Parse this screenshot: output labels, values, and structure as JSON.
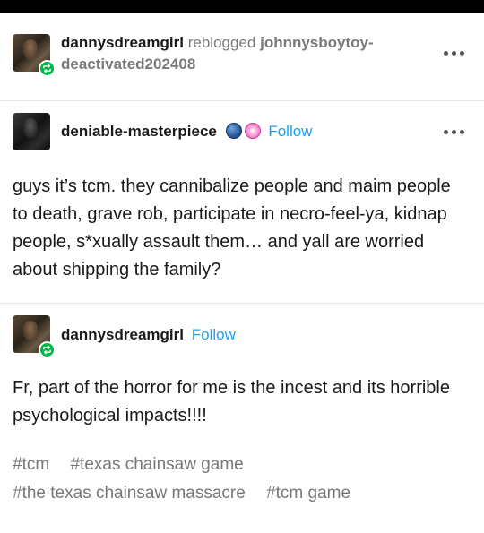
{
  "reblog_header": {
    "reblogger": "dannysdreamgirl",
    "action": "reblogged",
    "source_line1": "johnnysboytoy-",
    "source_line2": "deactivated202408"
  },
  "post1": {
    "author": "deniable-masterpiece",
    "follow_label": "Follow",
    "text": "guys it’s tcm. they cannibalize people and maim people to death, grave rob, participate in necro-feel-ya, kidnap people, s*xually assault them… and yall are worried about shipping the family?"
  },
  "post2": {
    "author": "dannysdreamgirl",
    "follow_label": "Follow",
    "text": "Fr, part of the horror for me is the incest and its horrible psychological impacts!!!!"
  },
  "tags": [
    "#tcm",
    "#texas chainsaw game",
    "#the texas chainsaw massacre",
    "#tcm game"
  ],
  "colors": {
    "follow": "#1da1f2",
    "reblog_badge": "#00b84a",
    "muted": "#7a7a7a"
  }
}
